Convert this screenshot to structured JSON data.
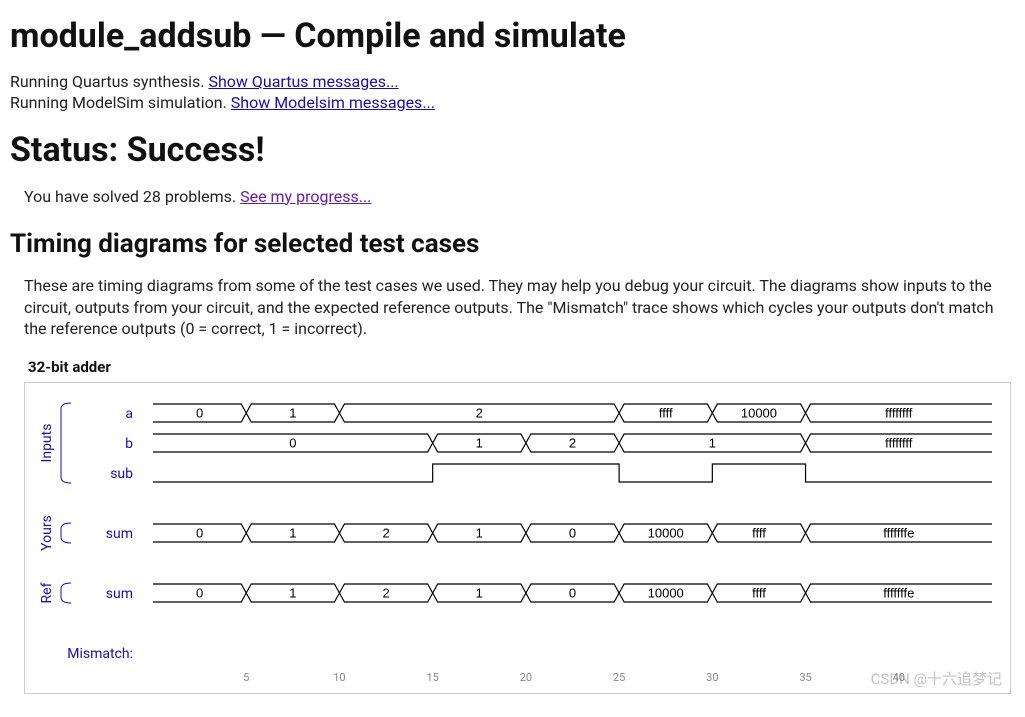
{
  "page_title": "module_addsub — Compile and simulate",
  "run_quartus_prefix": "Running Quartus synthesis. ",
  "run_quartus_link": "Show Quartus messages...",
  "run_modelsim_prefix": "Running ModelSim simulation. ",
  "run_modelsim_link": "Show Modelsim messages...",
  "status_heading": "Status: Success!",
  "progress_prefix": "You have solved 28 problems. ",
  "progress_link": "See my progress...",
  "timing_heading": "Timing diagrams for selected test cases",
  "timing_desc": "These are timing diagrams from some of the test cases we used. They may help you debug your circuit. The diagrams show inputs to the circuit, outputs from your circuit, and the expected reference outputs. The \"Mismatch\" trace shows which cycles your outputs don't match the reference outputs (0 = correct, 1 = incorrect).",
  "diagram_title": "32-bit adder",
  "watermark": "CSDN @十六追梦记",
  "groups": {
    "inputs": "Inputs",
    "yours": "Yours",
    "ref": "Ref"
  },
  "signals": {
    "a": "a",
    "b": "b",
    "sub": "sub",
    "sum_yours": "sum",
    "sum_ref": "sum",
    "mismatch": "Mismatch:"
  },
  "axis_ticks": [
    "5",
    "10",
    "15",
    "20",
    "25",
    "30",
    "35",
    "40"
  ],
  "chart_data": {
    "type": "timing",
    "x_range_ticks": [
      5,
      10,
      15,
      20,
      25,
      30,
      35,
      40
    ],
    "traces": [
      {
        "name": "a",
        "kind": "bus",
        "segments": [
          {
            "start": 0,
            "end": 5,
            "val": "0"
          },
          {
            "start": 5,
            "end": 10,
            "val": "1"
          },
          {
            "start": 10,
            "end": 25,
            "val": "2"
          },
          {
            "start": 25,
            "end": 30,
            "val": "ffff"
          },
          {
            "start": 30,
            "end": 35,
            "val": "10000"
          },
          {
            "start": 35,
            "end": 45,
            "val": "ffffffff"
          }
        ]
      },
      {
        "name": "b",
        "kind": "bus",
        "segments": [
          {
            "start": 0,
            "end": 15,
            "val": "0"
          },
          {
            "start": 15,
            "end": 20,
            "val": "1"
          },
          {
            "start": 20,
            "end": 25,
            "val": "2"
          },
          {
            "start": 25,
            "end": 35,
            "val": "1"
          },
          {
            "start": 35,
            "end": 45,
            "val": "ffffffff"
          }
        ]
      },
      {
        "name": "sub",
        "kind": "bit",
        "points": [
          {
            "t": 0,
            "v": 0
          },
          {
            "t": 15,
            "v": 0
          },
          {
            "t": 15,
            "v": 1
          },
          {
            "t": 25,
            "v": 1
          },
          {
            "t": 25,
            "v": 0
          },
          {
            "t": 30,
            "v": 0
          },
          {
            "t": 30,
            "v": 1
          },
          {
            "t": 35,
            "v": 1
          },
          {
            "t": 35,
            "v": 0
          },
          {
            "t": 45,
            "v": 0
          }
        ]
      },
      {
        "name": "sum_yours",
        "kind": "bus",
        "segments": [
          {
            "start": 0,
            "end": 5,
            "val": "0"
          },
          {
            "start": 5,
            "end": 10,
            "val": "1"
          },
          {
            "start": 10,
            "end": 15,
            "val": "2"
          },
          {
            "start": 15,
            "end": 20,
            "val": "1"
          },
          {
            "start": 20,
            "end": 25,
            "val": "0"
          },
          {
            "start": 25,
            "end": 30,
            "val": "10000"
          },
          {
            "start": 30,
            "end": 35,
            "val": "ffff"
          },
          {
            "start": 35,
            "end": 45,
            "val": "fffffffe"
          }
        ]
      },
      {
        "name": "sum_ref",
        "kind": "bus",
        "segments": [
          {
            "start": 0,
            "end": 5,
            "val": "0"
          },
          {
            "start": 5,
            "end": 10,
            "val": "1"
          },
          {
            "start": 10,
            "end": 15,
            "val": "2"
          },
          {
            "start": 15,
            "end": 20,
            "val": "1"
          },
          {
            "start": 20,
            "end": 25,
            "val": "0"
          },
          {
            "start": 25,
            "end": 30,
            "val": "10000"
          },
          {
            "start": 30,
            "end": 35,
            "val": "ffff"
          },
          {
            "start": 35,
            "end": 45,
            "val": "fffffffe"
          }
        ]
      },
      {
        "name": "mismatch",
        "kind": "bit",
        "points": [
          {
            "t": 0,
            "v": 0
          },
          {
            "t": 45,
            "v": 0
          }
        ]
      }
    ]
  }
}
